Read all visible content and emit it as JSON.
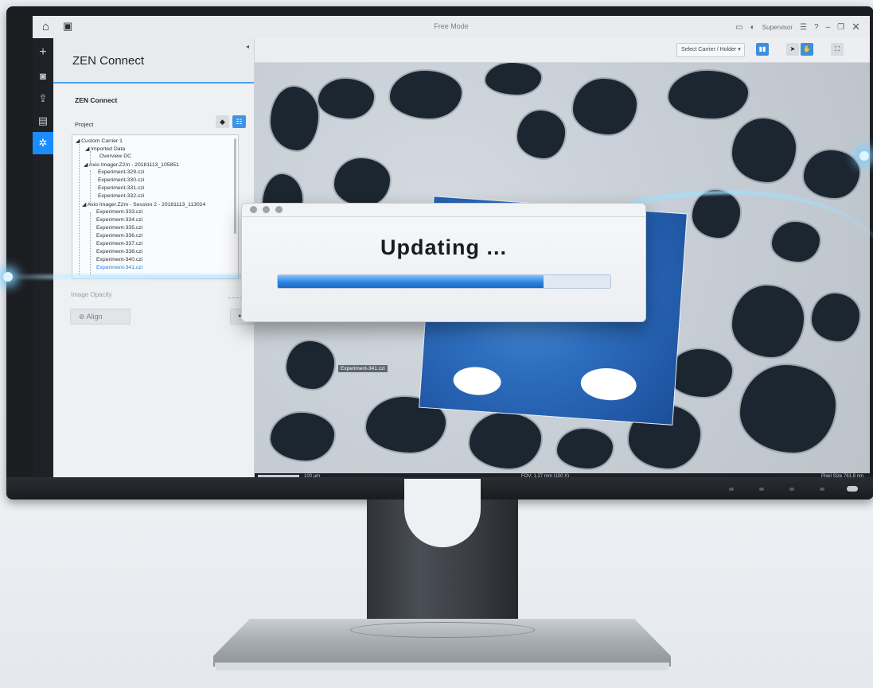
{
  "window": {
    "title": "Free Mode",
    "user": "Supervisor"
  },
  "panel": {
    "title": "ZEN Connect",
    "section_title": "ZEN Connect",
    "project_label": "Project",
    "opacity_label": "Image Opacity",
    "align_label": "Align"
  },
  "tree": [
    {
      "label": "Custom Carrier 1"
    },
    {
      "label": "Imported Data"
    },
    {
      "label": "Overview DC"
    },
    {
      "label": "Axio Imager.Z2m - 20181113_105851"
    },
    {
      "label": "Experiment-329.czi"
    },
    {
      "label": "Experiment-330.czi"
    },
    {
      "label": "Experiment-331.czi"
    },
    {
      "label": "Experiment-332.czi"
    },
    {
      "label": "Axio Imager.Z2m - Session 2 - 20181113_113024"
    },
    {
      "label": "Experiment-333.czi"
    },
    {
      "label": "Experiment-334.czi"
    },
    {
      "label": "Experiment-335.czi"
    },
    {
      "label": "Experiment-336.czi"
    },
    {
      "label": "Experiment-337.czi"
    },
    {
      "label": "Experiment-338.czi"
    },
    {
      "label": "Experiment-340.czi"
    },
    {
      "label": "Experiment-341.czi"
    }
  ],
  "viewer": {
    "carrier_select": "Select Carrier / Holder",
    "tile_label": "Experiment-341.czi",
    "scale": "100 µm",
    "fov": "FOV: 1,27 mm (100 X)",
    "pixel_size": "Pixel Size  761,8 nm"
  },
  "dialog": {
    "title": "Updating ...",
    "progress": 0.8
  },
  "colors": {
    "accent": "#1a8cff",
    "nav_bg": "#1e2126",
    "progress": "#2d86e0"
  }
}
